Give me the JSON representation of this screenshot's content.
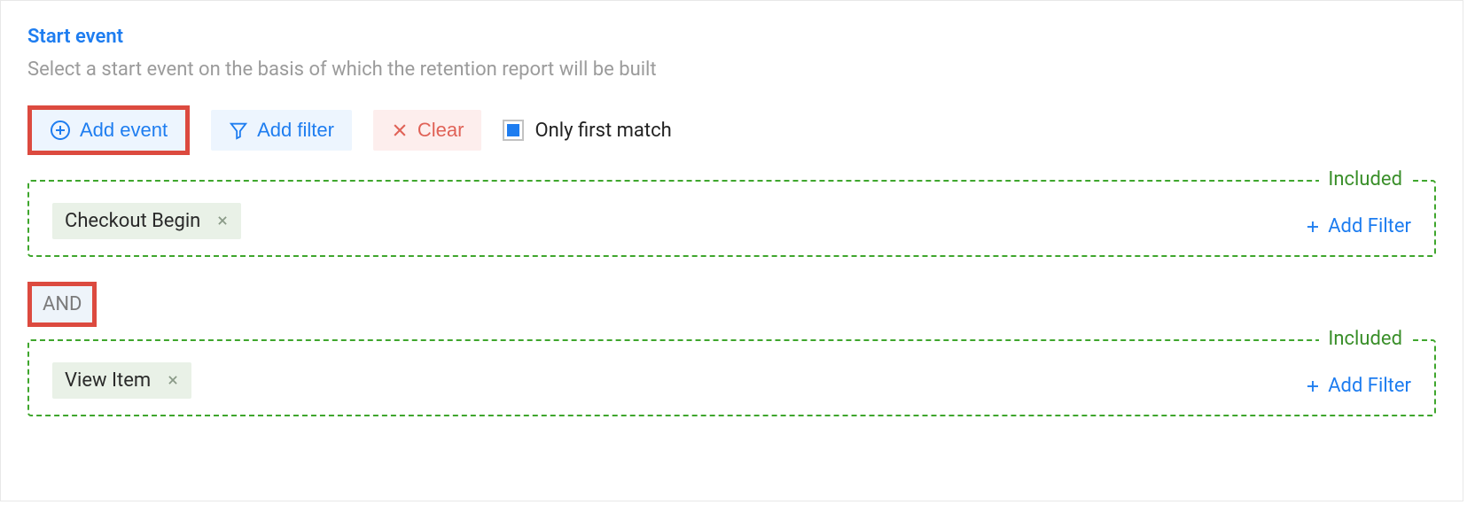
{
  "header": {
    "title": "Start event",
    "subtitle": "Select a start event on the basis of which the retention report will be built"
  },
  "toolbar": {
    "add_event_label": "Add event",
    "add_filter_label": "Add filter",
    "clear_label": "Clear",
    "only_first_match_label": "Only first match",
    "only_first_match_checked": true
  },
  "logic_operator": "AND",
  "blocks": [
    {
      "legend": "Included",
      "event_name": "Checkout Begin",
      "add_filter_label": "Add Filter"
    },
    {
      "legend": "Included",
      "event_name": "View Item",
      "add_filter_label": "Add Filter"
    }
  ]
}
